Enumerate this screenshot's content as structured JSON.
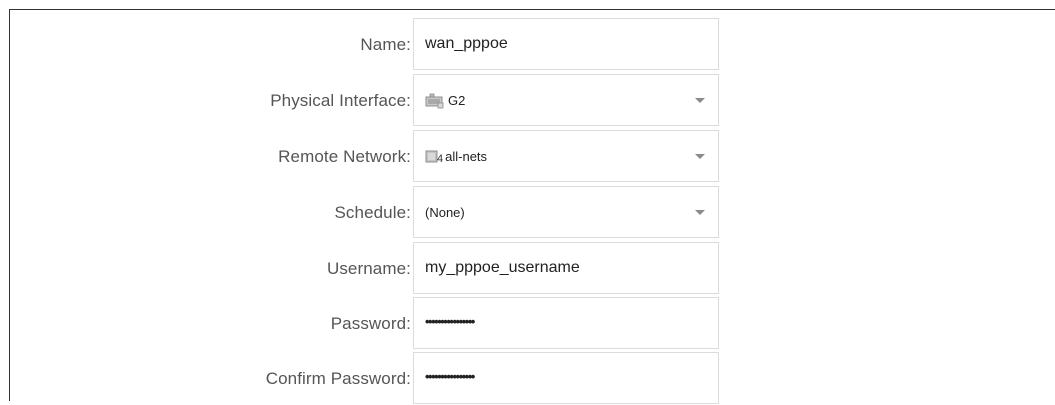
{
  "form": {
    "name": {
      "label": "Name:",
      "value": "wan_pppoe"
    },
    "physical_interface": {
      "label": "Physical Interface:",
      "value": "G2",
      "icon": "network-interface-icon"
    },
    "remote_network": {
      "label": "Remote Network:",
      "value": "all-nets",
      "icon": "address-object-icon",
      "icon_badge": "4"
    },
    "schedule": {
      "label": "Schedule:",
      "value": "(None)"
    },
    "username": {
      "label": "Username:",
      "value": "my_pppoe_username"
    },
    "password": {
      "label": "Password:",
      "value": "••••••••••••••••"
    },
    "confirm_password": {
      "label": "Confirm Password:",
      "value": "••••••••••••••••"
    }
  },
  "colors": {
    "label_text": "#555555",
    "field_border": "#dcdcdc",
    "frame_border": "#333333",
    "caret": "#8a8a8a"
  }
}
